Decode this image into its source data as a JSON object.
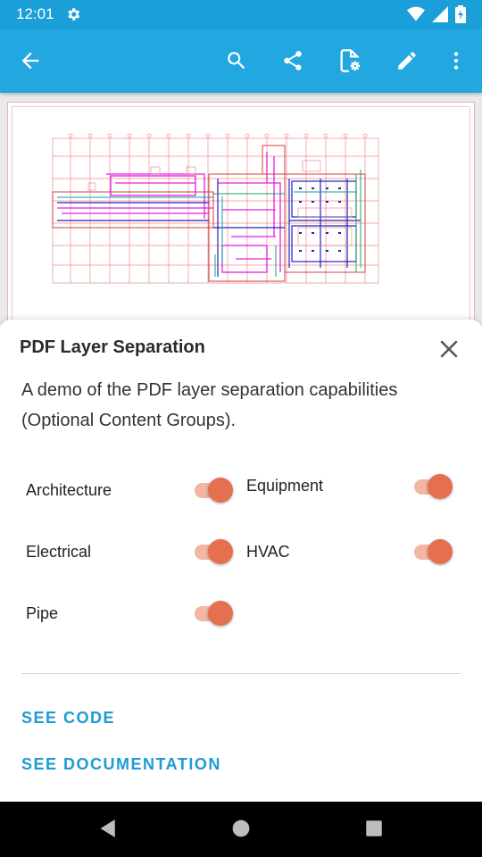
{
  "status_bar": {
    "time": "12:01"
  },
  "app_bar": {
    "icons": [
      "back-arrow-icon",
      "search-icon",
      "share-icon",
      "document-settings-icon",
      "edit-pencil-icon",
      "more-vert-icon"
    ]
  },
  "sheet": {
    "title": "PDF Layer Separation",
    "description": "A demo of the PDF layer separation capabilities (Optional Content Groups).",
    "layers": [
      {
        "label": "Architecture",
        "on": true
      },
      {
        "label": "Equipment",
        "on": true
      },
      {
        "label": "Electrical",
        "on": true
      },
      {
        "label": "HVAC",
        "on": true
      },
      {
        "label": "Pipe",
        "on": true
      }
    ],
    "see_code": "SEE CODE",
    "see_docs": "SEE DOCUMENTATION"
  },
  "colors": {
    "app_bar": "#22a7e0",
    "status_bar": "#1a9fd9",
    "accent": "#e4704f",
    "accent_track": "#f2b6a2",
    "link": "#1e9ad6"
  }
}
